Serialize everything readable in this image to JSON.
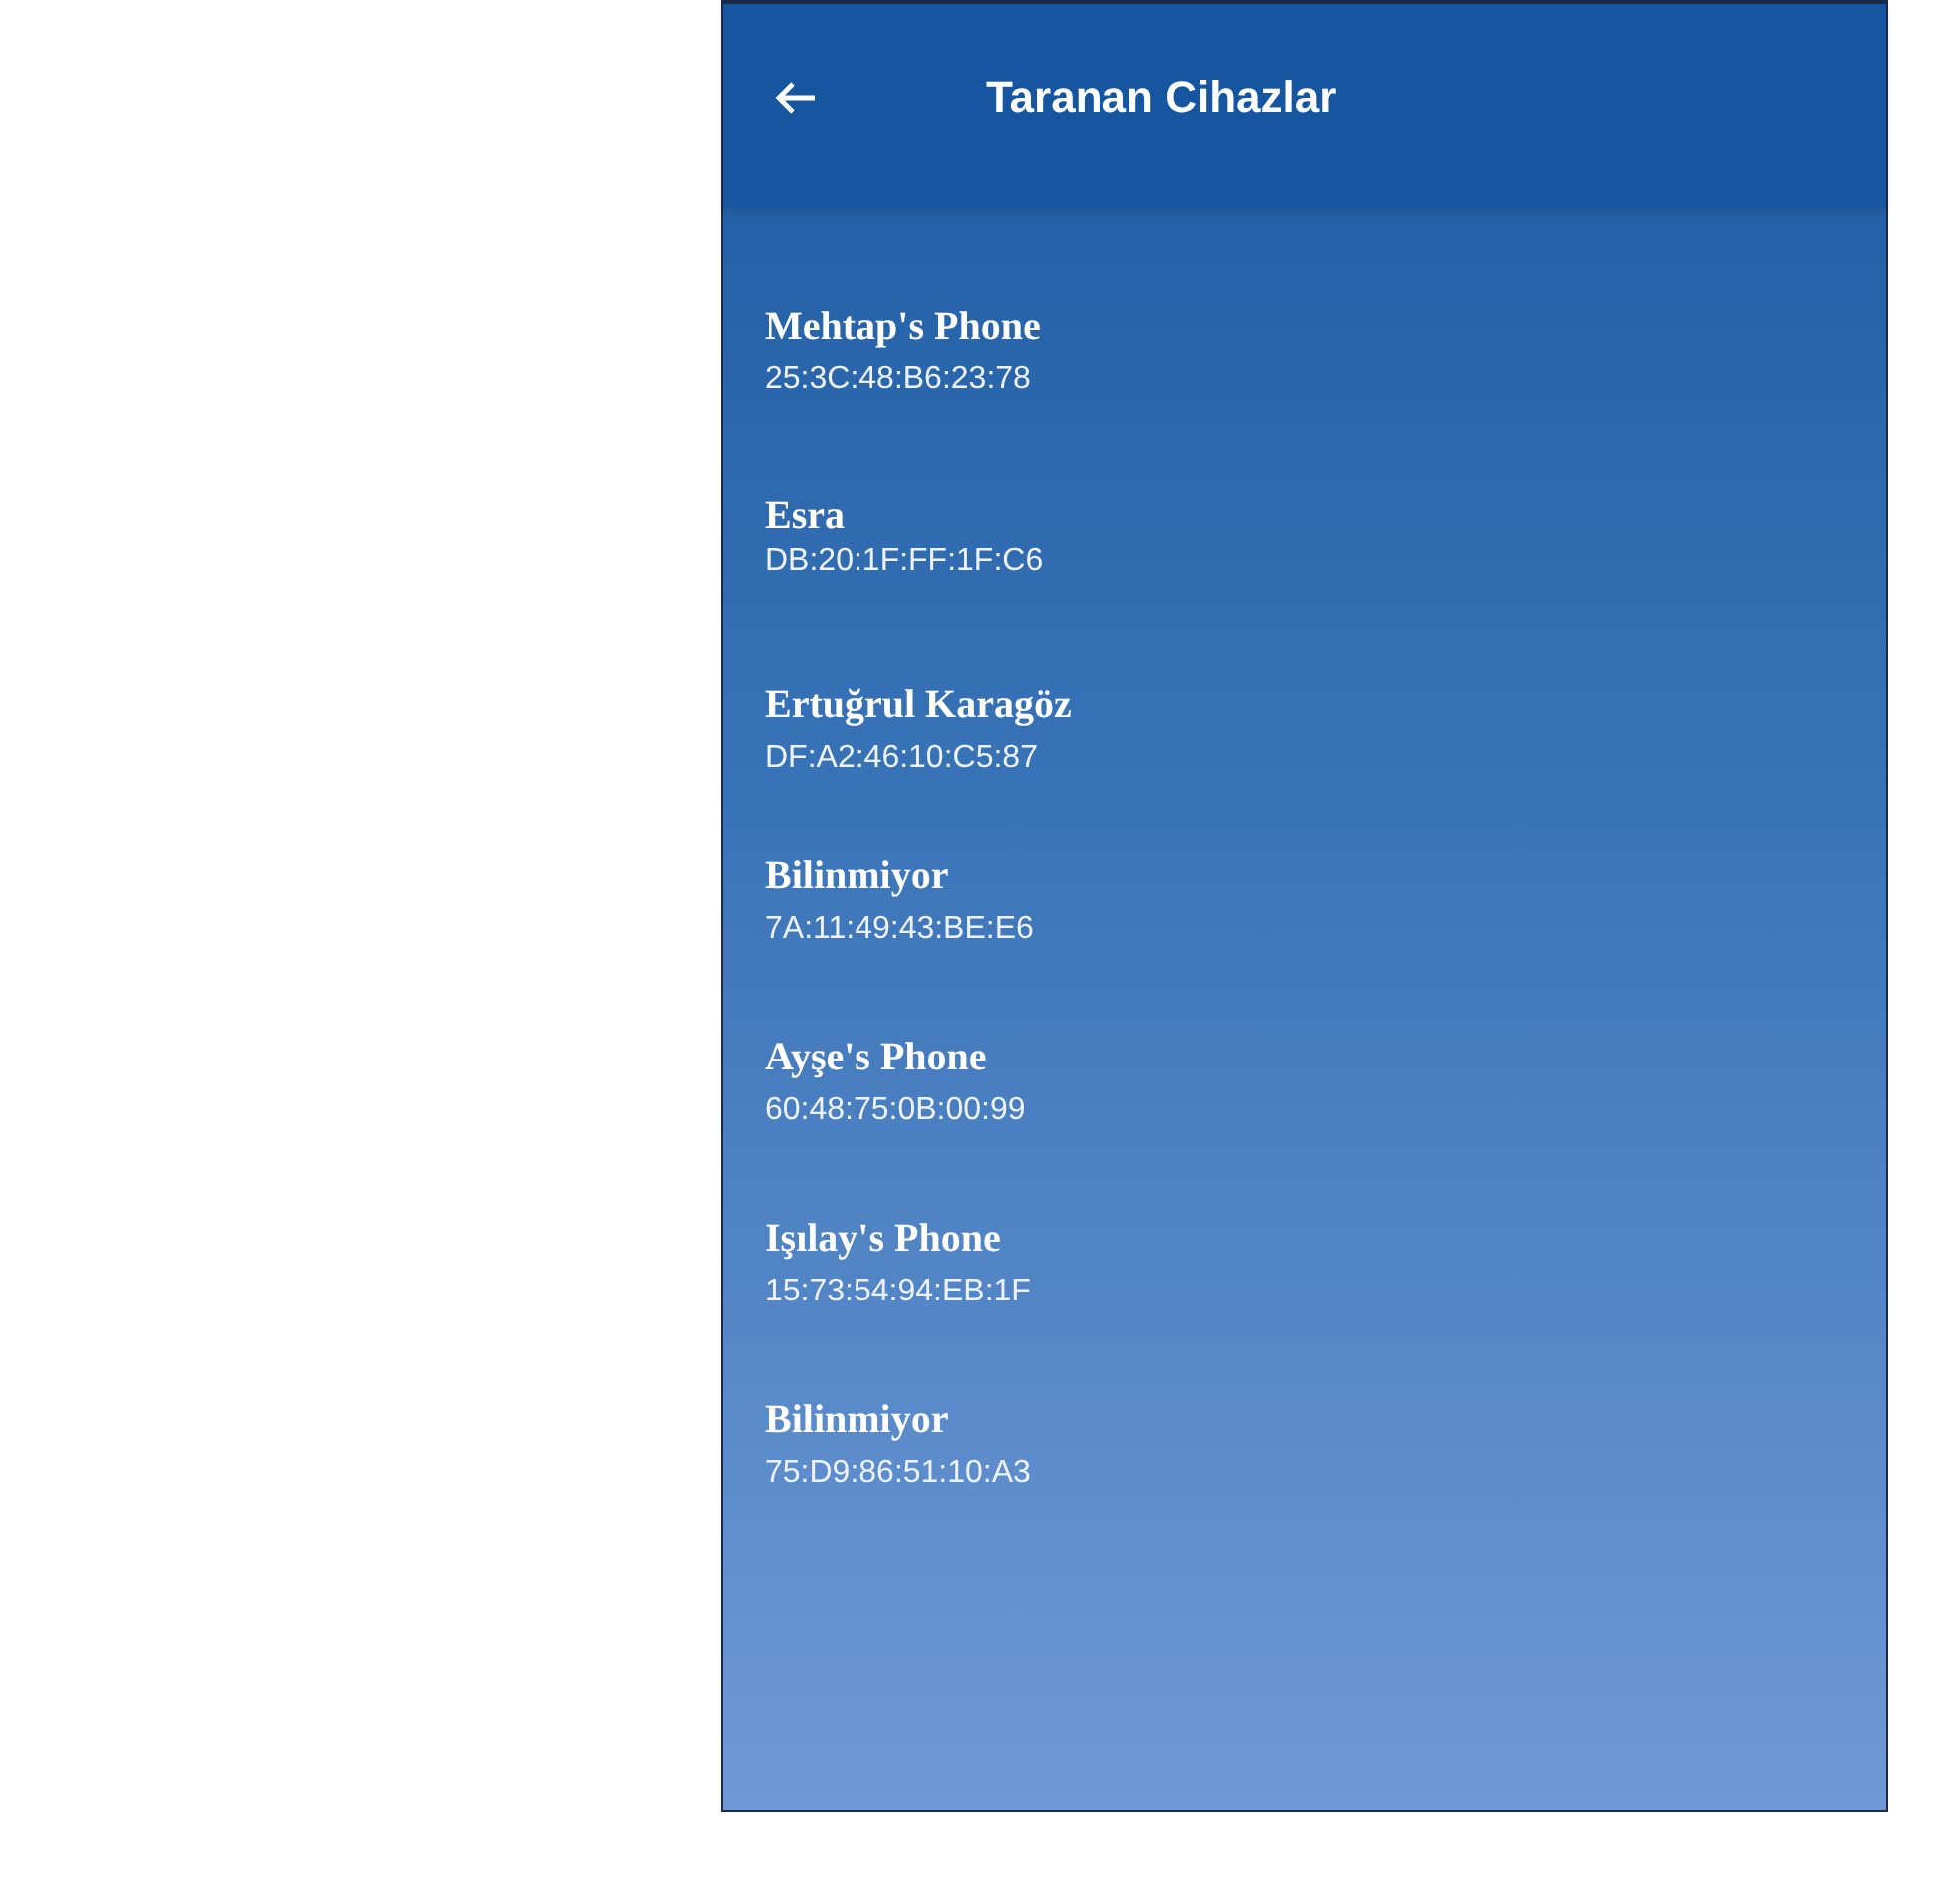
{
  "app_bar": {
    "title": "Taranan Cihazlar"
  },
  "devices": [
    {
      "name": "Mehtap's Phone",
      "address": "25:3C:48:B6:23:78"
    },
    {
      "name": "Esra",
      "address": "DB:20:1F:FF:1F:C6"
    },
    {
      "name": "Ertuğrul Karagöz",
      "address": "DF:A2:46:10:C5:87"
    },
    {
      "name": "Bilinmiyor",
      "address": "7A:11:49:43:BE:E6"
    },
    {
      "name": "Ayşe's Phone",
      "address": "60:48:75:0B:00:99"
    },
    {
      "name": "Işılay's Phone",
      "address": "15:73:54:94:EB:1F"
    },
    {
      "name": "Bilinmiyor",
      "address": "75:D9:86:51:10:A3"
    }
  ]
}
